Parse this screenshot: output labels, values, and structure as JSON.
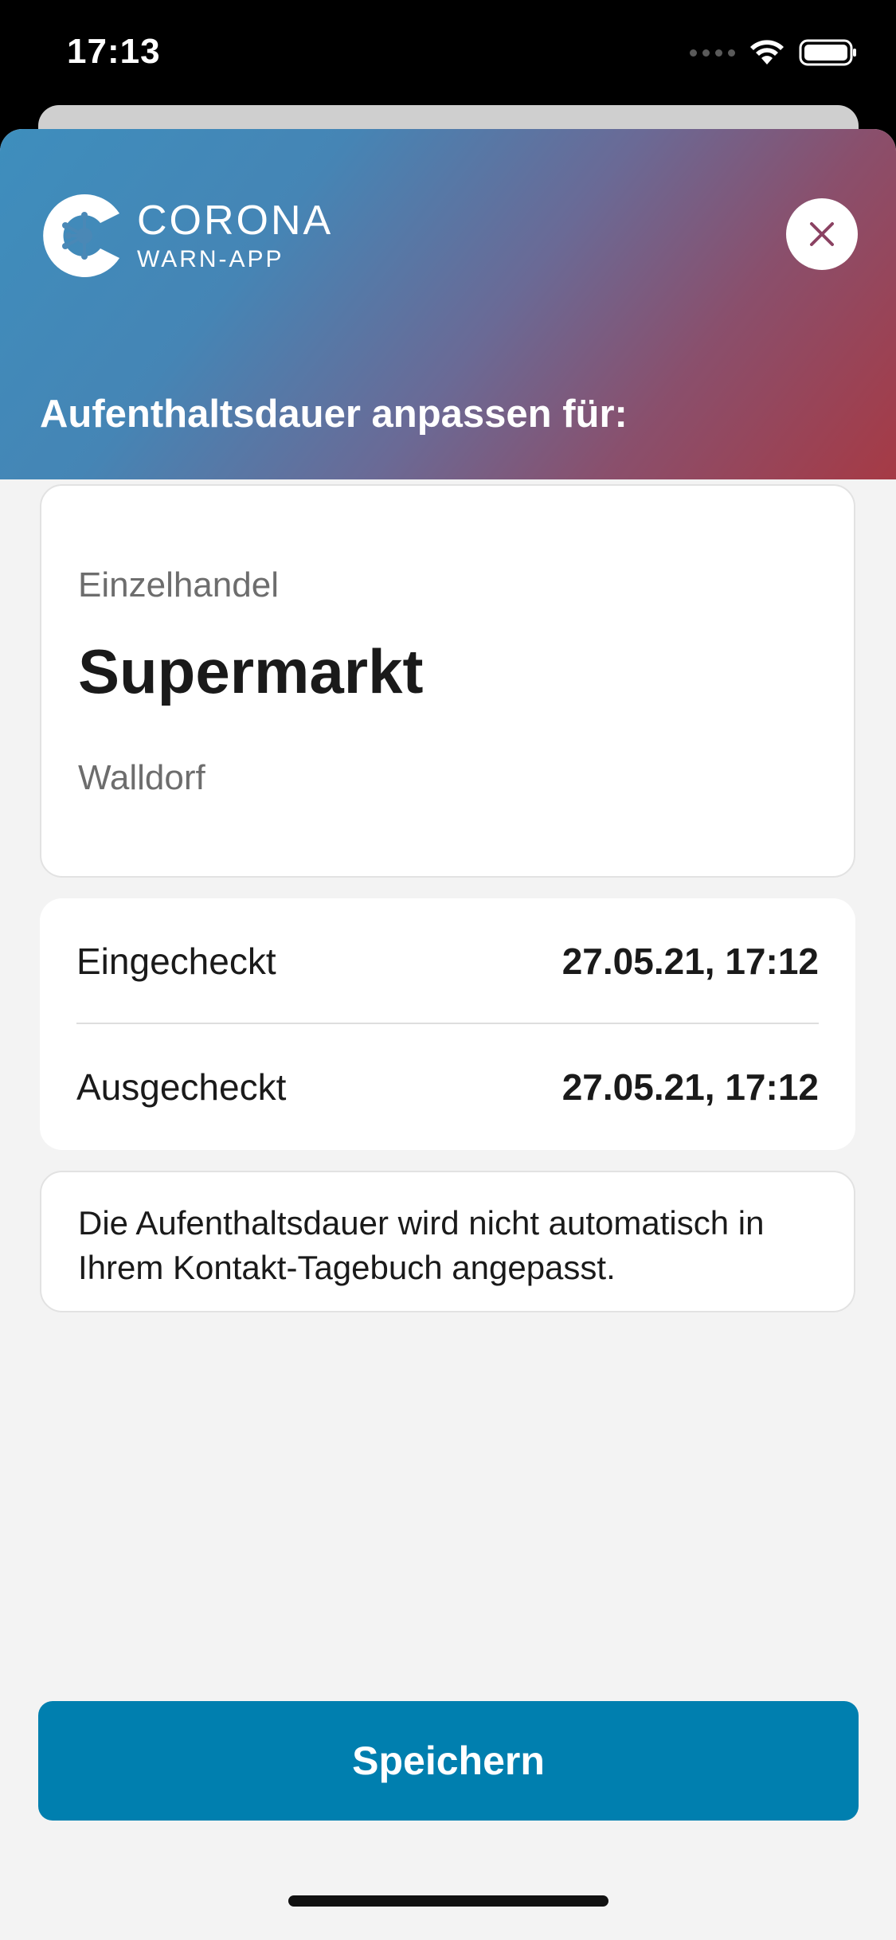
{
  "status_bar": {
    "time": "17:13",
    "icons": [
      "signal-icon",
      "wifi-icon",
      "battery-icon"
    ]
  },
  "header": {
    "logo_line1": "CORONA",
    "logo_line2": "WARN-APP",
    "title": "Aufenthaltsdauer anpassen für:",
    "close_icon": "close-icon",
    "gradient_colors": [
      "#3e8ebd",
      "#6a6a96",
      "#a63a45"
    ]
  },
  "location": {
    "type": "Einzelhandel",
    "name": "Supermarkt",
    "address": "Walldorf"
  },
  "times": [
    {
      "label": "Eingecheckt",
      "value": "27.05.21, 17:12"
    },
    {
      "label": "Ausgecheckt",
      "value": "27.05.21, 17:12"
    }
  ],
  "info": {
    "text": "Die Aufenthaltsdauer wird nicht automatisch in Ihrem Kontakt-Tagebuch angepasst."
  },
  "actions": {
    "save_label": "Speichern",
    "save_color": "#007faf"
  }
}
